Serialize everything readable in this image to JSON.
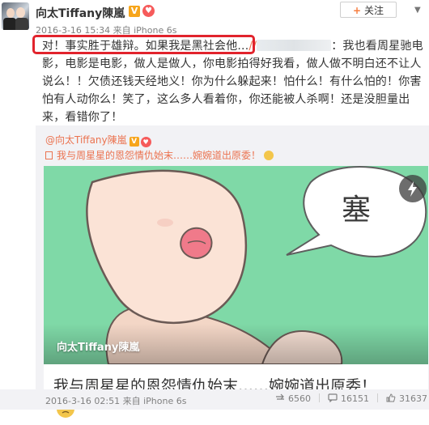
{
  "post": {
    "author": "向太Tiffany陳嵐",
    "verified_badge": "V",
    "meta": "2016-3-16 15:34 来自 iPhone 6s",
    "follow_label": "关注",
    "text_highlighted": "对！事实胜于雄辩。如果我是黑社会他...",
    "text_mention": "//",
    "text_rest": "：我也看周星驰电影，电影是电影，做人是做人，你电影拍得好我看，做人做不明白还不让人说么！！欠债还钱天经地义！你为什么躲起来！怕什么！有什么怕的！你害怕有人动你么！笑了，这么多人看着你，你还能被人杀啊！还是没胆量出来，看错你了！"
  },
  "repost": {
    "author": "@向太Tiffany陳嵐",
    "verified_badge": "V",
    "text": "我与周星星的恩怨情仇始末……婉婉道出原委！",
    "card": {
      "image_caption": "向太Tiffany陳嵐",
      "speech_text": "塞",
      "title": "我与周星星的恩怨情仇始末……婉婉道出原委！"
    }
  },
  "footer": {
    "meta": "2016-3-16 02:51 来自 iPhone 6s",
    "repost_count": "6560",
    "comment_count": "16151",
    "like_count": "31637"
  },
  "colors": {
    "accent_orange": "#eb7350",
    "highlight_red": "#e1232c",
    "image_green": "#7ed9a6"
  }
}
